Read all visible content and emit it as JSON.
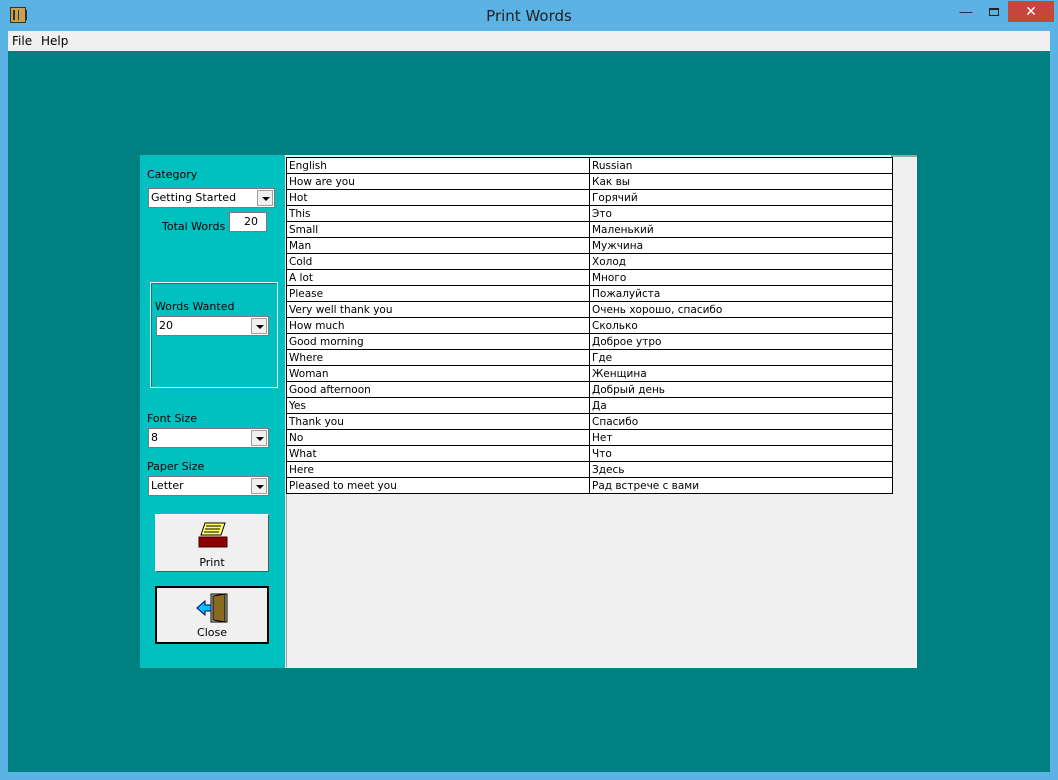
{
  "window": {
    "title": "Print Words"
  },
  "menu": {
    "file": "File",
    "help": "Help"
  },
  "left": {
    "category_label": "Category",
    "category_value": "Getting Started",
    "total_words_label": "Total Words",
    "total_words_value": "20",
    "words_wanted_label": "Words Wanted",
    "words_wanted_value": "20",
    "font_size_label": "Font Size",
    "font_size_value": "8",
    "paper_size_label": "Paper Size",
    "paper_size_value": "Letter",
    "print_label": "Print",
    "close_label": "Close"
  },
  "table": {
    "headers": [
      "English",
      "Russian"
    ],
    "rows": [
      [
        "How are you",
        "Как вы"
      ],
      [
        "Hot",
        "Горячий"
      ],
      [
        "This",
        "Это"
      ],
      [
        "Small",
        "Маленький"
      ],
      [
        "Man",
        "Мужчина"
      ],
      [
        "Cold",
        "Холод"
      ],
      [
        "A lot",
        "Много"
      ],
      [
        "Please",
        "Пожалуйста"
      ],
      [
        "Very well thank you",
        "Очень хорошо, спасибо"
      ],
      [
        "How much",
        "Сколько"
      ],
      [
        "Good morning",
        "Доброе утро"
      ],
      [
        "Where",
        "Где"
      ],
      [
        "Woman",
        "Женщина"
      ],
      [
        "Good afternoon",
        "Добрый день"
      ],
      [
        "Yes",
        "Да"
      ],
      [
        "Thank you",
        "Спасибо"
      ],
      [
        "No",
        "Нет"
      ],
      [
        "What",
        "Что"
      ],
      [
        "Here",
        "Здесь"
      ],
      [
        "Pleased to meet you",
        "Рад встрече с вами"
      ]
    ]
  },
  "colors": {
    "client_bg": "#008080",
    "left_panel": "#00c0c0",
    "title_bar": "#5bb2e4"
  },
  "icons": {
    "print": "printer-icon",
    "close": "door-exit-icon"
  }
}
